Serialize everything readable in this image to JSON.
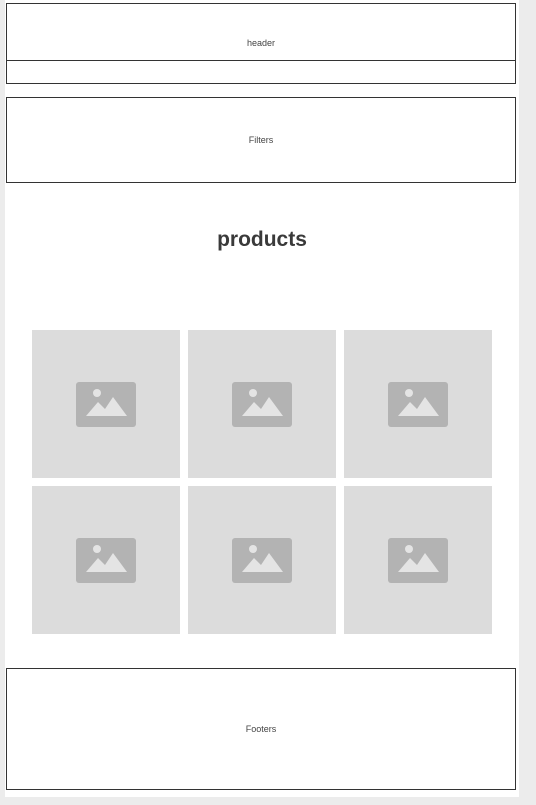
{
  "header": {
    "label": "header"
  },
  "nav": {
    "label": ""
  },
  "filters": {
    "label": "Filters"
  },
  "products": {
    "title": "products",
    "items": [
      {
        "icon": "image-placeholder-icon"
      },
      {
        "icon": "image-placeholder-icon"
      },
      {
        "icon": "image-placeholder-icon"
      },
      {
        "icon": "image-placeholder-icon"
      },
      {
        "icon": "image-placeholder-icon"
      },
      {
        "icon": "image-placeholder-icon"
      }
    ]
  },
  "footer": {
    "label": "Footers"
  },
  "colors": {
    "placeholder_bg": "#dcdcdc",
    "placeholder_icon": "#b3b3b3",
    "border": "#333333"
  }
}
